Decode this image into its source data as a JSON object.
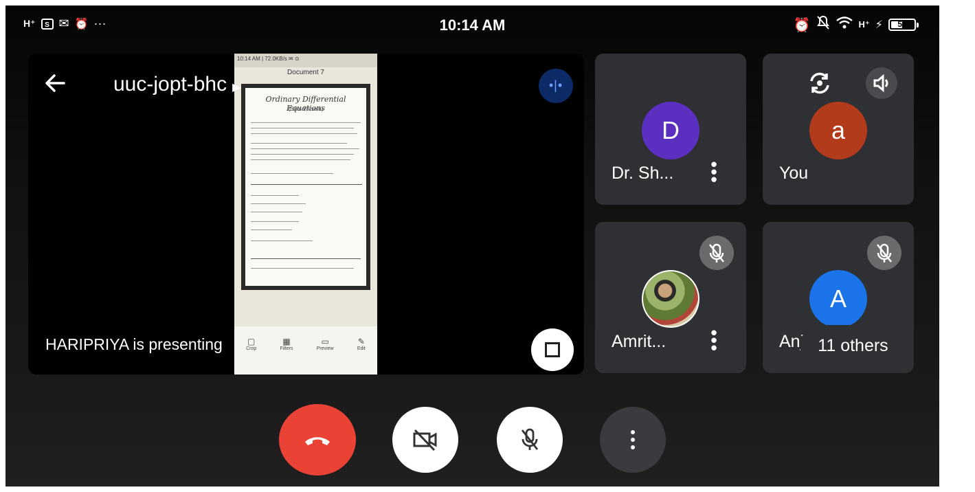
{
  "status_bar": {
    "network": "H⁺",
    "left_icons": [
      "S",
      "✉",
      "⏰",
      "···"
    ],
    "time": "10:14 AM",
    "right_icons": [
      "⏰",
      "🔕",
      "wifi",
      "H⁺",
      "⚡"
    ],
    "battery_level": 51,
    "battery_text": "51"
  },
  "presentation": {
    "meeting_code": "uuc-jopt-bhc",
    "presenter_text": "HARIPRIYA is presenting",
    "shared_screen": {
      "status_text": "10:14 AM | 72.0KB/s ✉ ⊙",
      "document_title": "Document 7",
      "paper_heading": "Ordinary Differential Equations",
      "paper_subheading": "(Sum PA soln)",
      "bottom_actions": [
        "Crop",
        "Filters",
        "Preview",
        "Edit"
      ]
    }
  },
  "participants": [
    {
      "name": "Dr. Sh...",
      "initial": "D",
      "color": "#5b2fbf",
      "muted": false
    },
    {
      "name": "You",
      "initial": "a",
      "color": "#b13b1a",
      "muted": false
    },
    {
      "name": "Amrit...",
      "initial": "",
      "color": "#6d8a3a",
      "muted": true
    },
    {
      "name": "Anji...",
      "initial": "A",
      "color": "#1a73e8",
      "muted": true
    }
  ],
  "others_label": "11 others",
  "colors": {
    "end_call": "#ea4335",
    "tile_bg": "#2f3033",
    "more_options": "#0c2a66"
  }
}
